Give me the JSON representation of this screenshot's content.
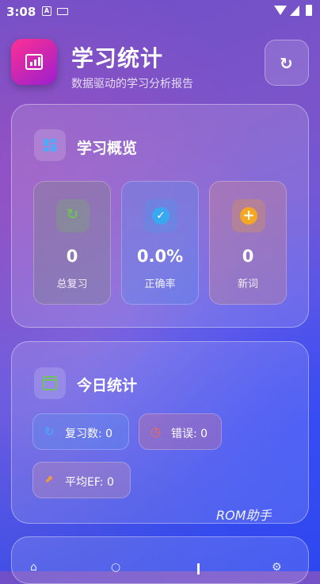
{
  "status_bar": {
    "time": "3:08",
    "notif_icons": [
      "A",
      "keyboard"
    ]
  },
  "header": {
    "title": "学习统计",
    "subtitle": "数据驱动的学习分析报告",
    "refresh_icon": "↻"
  },
  "overview": {
    "title": "学习概览",
    "stats": [
      {
        "value": "0",
        "label": "总复习",
        "icon": "↻",
        "color": "#6fc25a"
      },
      {
        "value": "0.0%",
        "label": "正确率",
        "icon": "✓",
        "color": "#3aa8f0"
      },
      {
        "value": "0",
        "label": "新词",
        "icon": "+",
        "color": "#f5a623"
      }
    ]
  },
  "today": {
    "title": "今日统计",
    "pills": [
      {
        "text": "复习数: 0",
        "icon": "↻",
        "color": "#4fa3f7"
      },
      {
        "text": "错误: 0",
        "icon": "◷",
        "color": "#ff6a4a"
      },
      {
        "text": "平均EF: 0",
        "icon": "📈",
        "color": "#f29b3c"
      }
    ]
  },
  "watermark": "ROM助手",
  "nav": [
    "home",
    "search",
    "stats",
    "settings"
  ]
}
